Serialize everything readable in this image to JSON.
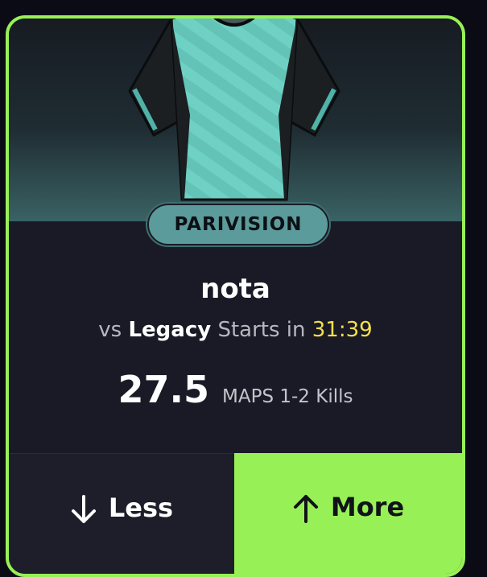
{
  "card": {
    "team": "PARIVISION",
    "player": "nota",
    "matchup": {
      "vs_prefix": "vs",
      "opponent": "Legacy",
      "starts_label": "Starts in",
      "countdown": "31:39"
    },
    "line_value": "27.5",
    "stat_label": "MAPS 1-2 Kills"
  },
  "actions": {
    "less_label": "Less",
    "more_label": "More"
  },
  "colors": {
    "accent": "#98f057",
    "badge": "#5b9b9b",
    "countdown": "#f4e04d",
    "card_bg": "#1a1a26"
  },
  "icons": {
    "less": "arrow-down-icon",
    "more": "arrow-up-icon",
    "jersey": "jersey-image"
  }
}
